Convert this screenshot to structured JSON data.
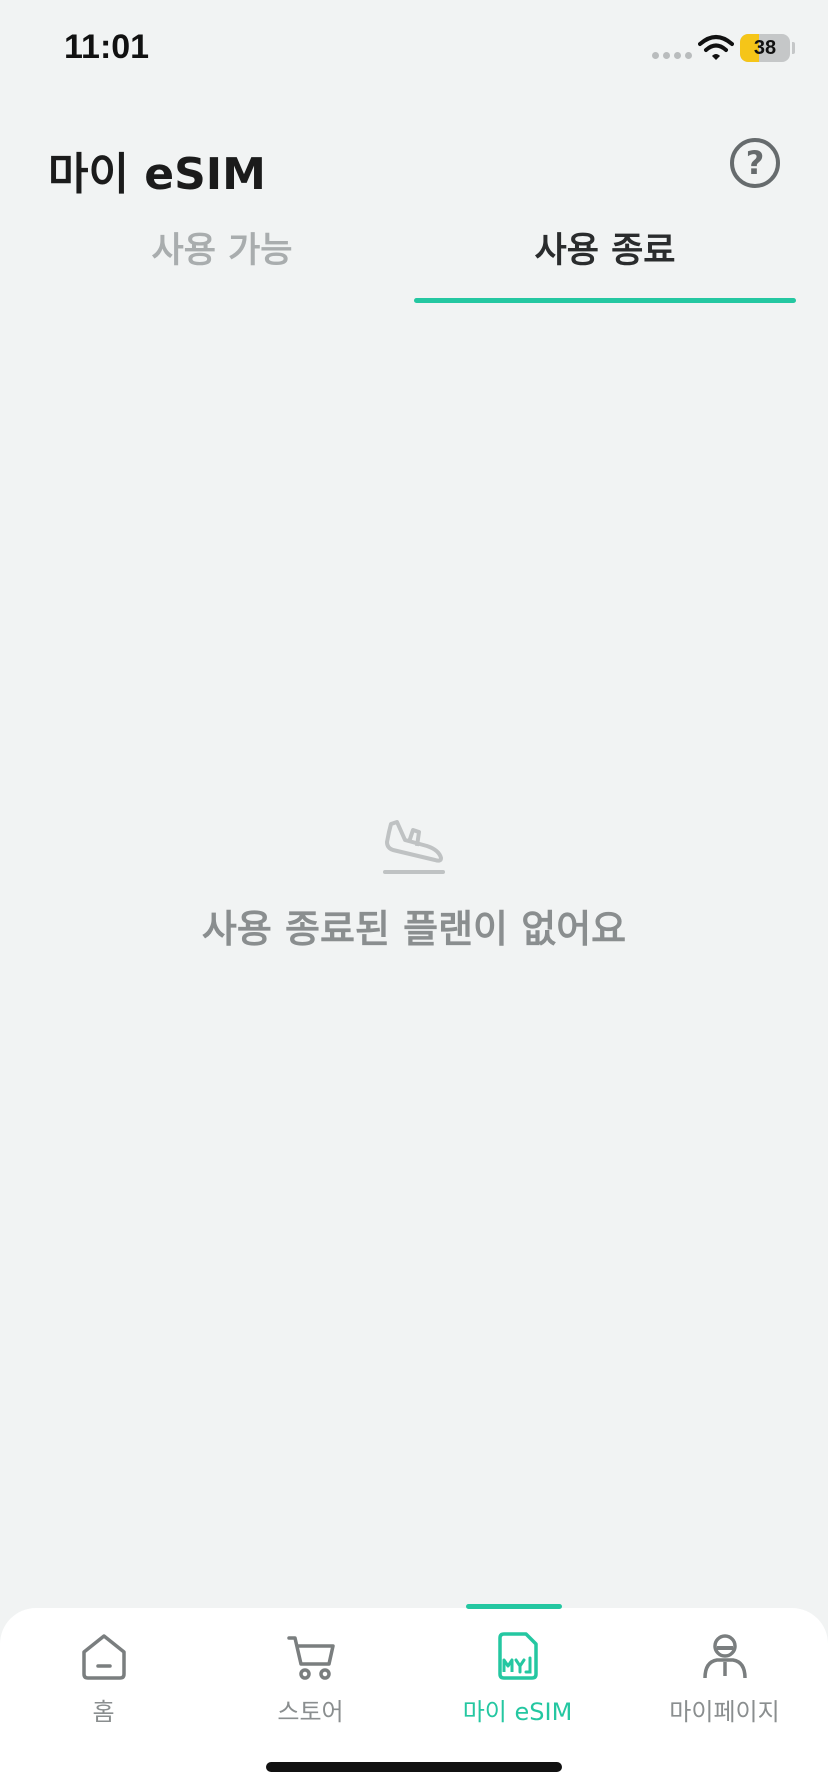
{
  "status_bar": {
    "time": "11:01",
    "battery": "38",
    "battery_level": 0.38
  },
  "header": {
    "title": "마이 eSIM",
    "help_label": "?"
  },
  "tabs": [
    {
      "label": "사용 가능",
      "active": false
    },
    {
      "label": "사용 종료",
      "active": true
    }
  ],
  "empty_state": {
    "message": "사용 종료된 플랜이 없어요",
    "icon": "plane-landing-icon"
  },
  "bottom_nav": {
    "items": [
      {
        "label": "홈",
        "icon": "home-icon",
        "active": false
      },
      {
        "label": "스토어",
        "icon": "cart-icon",
        "active": false
      },
      {
        "label": "마이 eSIM",
        "icon": "my-sim-icon",
        "active": true
      },
      {
        "label": "마이페이지",
        "icon": "profile-icon",
        "active": false
      }
    ]
  },
  "colors": {
    "accent": "#24c7a1",
    "background": "#f1f3f3",
    "muted_text": "#8a8e8f",
    "battery_fill": "#f5c518"
  }
}
